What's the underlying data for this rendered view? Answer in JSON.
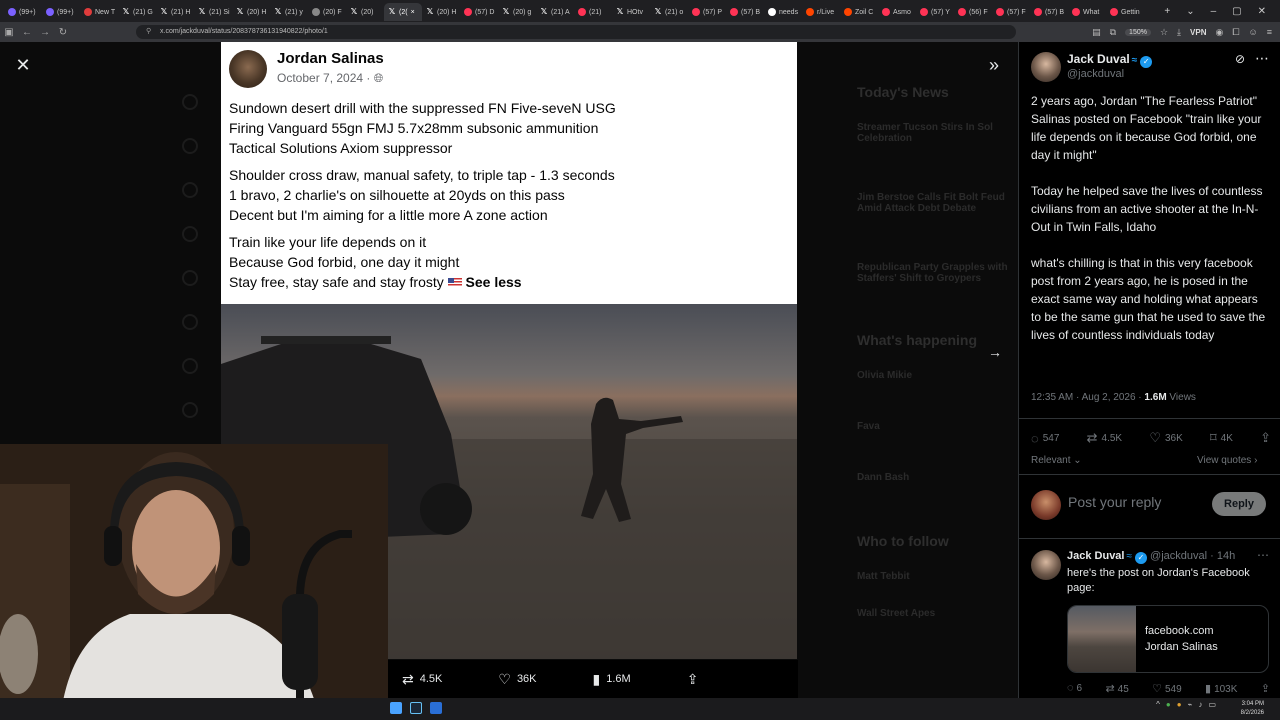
{
  "browser": {
    "tabs": [
      {
        "label": "(99+)",
        "fav": "#7b61ff",
        "x": false
      },
      {
        "label": "(99+)",
        "fav": "#7b61ff",
        "x": false
      },
      {
        "label": "New T",
        "fav": "#e03c3c",
        "x": false
      },
      {
        "label": "(21) G",
        "fav": "",
        "x": true
      },
      {
        "label": "(21) H",
        "fav": "",
        "x": true
      },
      {
        "label": "(21) Si",
        "fav": "",
        "x": true
      },
      {
        "label": "(20) H",
        "fav": "",
        "x": true
      },
      {
        "label": "(21) y",
        "fav": "",
        "x": true
      },
      {
        "label": "(20) F",
        "fav": "#888",
        "x": false
      },
      {
        "label": "(20) ",
        "fav": "",
        "x": true
      },
      {
        "label": "(20) H",
        "fav": "",
        "x": true
      },
      {
        "label": "(57) D",
        "fav": "#ff3355",
        "x": false
      },
      {
        "label": "(20) g",
        "fav": "",
        "x": true
      },
      {
        "label": "(21) A",
        "fav": "",
        "x": true
      },
      {
        "label": "(21)",
        "fav": "#ff3355",
        "x": false
      },
      {
        "label": "HOtv",
        "fav": "",
        "x": true
      },
      {
        "label": "(21) o",
        "fav": "",
        "x": true
      },
      {
        "label": "(57) P",
        "fav": "#ff3355",
        "x": false
      },
      {
        "label": "(57) B",
        "fav": "#ff3355",
        "x": false
      },
      {
        "label": "needs",
        "fav": "#ffffff",
        "x": false
      },
      {
        "label": "r/Live",
        "fav": "#ff4500",
        "x": false
      },
      {
        "label": "Zoil C",
        "fav": "#ff4500",
        "x": false
      },
      {
        "label": "Asmo",
        "fav": "#ff3355",
        "x": false
      },
      {
        "label": "(57) Y",
        "fav": "#ff3355",
        "x": false
      },
      {
        "label": "(56) F",
        "fav": "#ff3355",
        "x": false
      },
      {
        "label": "(57) F",
        "fav": "#ff3355",
        "x": false
      },
      {
        "label": "(57) B",
        "fav": "#ff3355",
        "x": false
      },
      {
        "label": "What",
        "fav": "#ff3355",
        "x": false
      },
      {
        "label": "Gettin",
        "fav": "#ff3355",
        "x": false
      }
    ],
    "active_tab_label": "(2(",
    "url": "x.com/jackduval/status/2083787361319408​22/photo/1",
    "zoom": "150%",
    "vpn": "VPN"
  },
  "background_page": {
    "headings": [
      "Today's News",
      "What's happening",
      "Who to follow"
    ],
    "news": [
      "Streamer Tucson Stirs In Sol Celebration",
      "Jim Berstoe Calls Fit Bolt Feud Amid Attack Debt Debate",
      "Republican Party Grapples with Staffers' Shift to Groypers"
    ],
    "happening": [
      "Olivia Mikie",
      "Fava",
      "Dann Bash"
    ],
    "follow": [
      "Matt Tebbit",
      "Wall Street Apes"
    ]
  },
  "fb_post": {
    "name": "Jordan Salinas",
    "date": "October 7, 2024 ·",
    "para1": [
      "Sundown desert drill with the suppressed FN Five-seveN USG",
      "Firing Vanguard 55gn FMJ 5.7x28mm subsonic ammunition",
      "Tactical Solutions Axiom suppressor"
    ],
    "para2": [
      "Shoulder cross draw, manual safety, to triple tap - 1.3 seconds",
      "1 bravo, 2 charlie's on silhouette at 20yds on this pass",
      "Decent but I'm aiming for a little more A zone action"
    ],
    "para3": [
      "Train like your life depends on it",
      "Because God forbid, one day it might",
      "Stay free, stay safe and stay frosty"
    ],
    "see_less": "See less"
  },
  "photo_actions": {
    "retweets": "4.5K",
    "likes": "36K",
    "views": "1.6M"
  },
  "tweet": {
    "author": "Jack Duval",
    "handle": "@jackduval",
    "text": "2 years ago, Jordan \"The Fearless Patriot\" Salinas posted on Facebook \"train like your life depends on it because God forbid, one day it might\"\n\nToday he helped save the lives of countless civilians from an active shooter at the In-N-Out in Twin Falls, Idaho\n\nwhat's chilling is that in this very facebook post from 2 years ago, he is posed in the exact same way and holding what appears to be the same gun that he used to save the lives of countless individuals today",
    "time": "12:35 AM · Aug 2, 2026 · ",
    "views_count": "1.6M",
    "views_label": " Views",
    "replies": "547",
    "retweets": "4.5K",
    "likes": "36K",
    "bookmarks": "4K",
    "relevant": "Relevant",
    "view_quotes": "View quotes",
    "reply_placeholder": "Post your reply",
    "reply_button": "Reply"
  },
  "reply": {
    "author": "Jack Duval",
    "handle": "@jackduval · 14h",
    "text": "here's the post on Jordan's Facebook page:",
    "card_domain": "facebook.com",
    "card_title": "Jordan Salinas",
    "replies": "6",
    "retweets": "45",
    "likes": "549",
    "views": "103K"
  },
  "taskbar": {
    "time": "3:04 PM",
    "date": "8/2/2026"
  }
}
